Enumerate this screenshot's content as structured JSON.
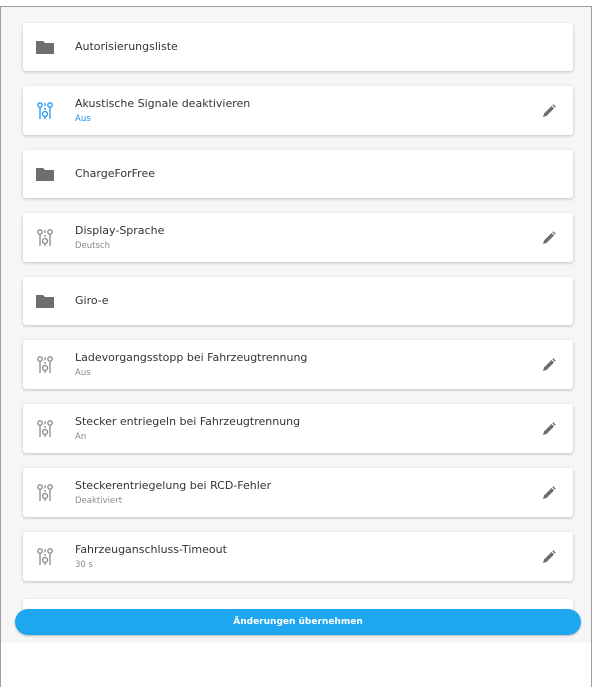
{
  "settings": [
    {
      "label": "Autorisierungsliste",
      "type": "folder"
    },
    {
      "label": "Akustische Signale deaktivieren",
      "value": "Aus",
      "type": "setting",
      "highlighted": true
    },
    {
      "label": "ChargeForFree",
      "type": "folder"
    },
    {
      "label": "Display-Sprache",
      "value": "Deutsch",
      "type": "setting"
    },
    {
      "label": "Giro-e",
      "type": "folder"
    },
    {
      "label": "Ladevorgangsstopp bei Fahrzeugtrennung",
      "value": "Aus",
      "type": "setting"
    },
    {
      "label": "Stecker entriegeln bei Fahrzeugtrennung",
      "value": "An",
      "type": "setting"
    },
    {
      "label": "Steckerentriegelung bei RCD-Fehler",
      "value": "Deaktiviert",
      "type": "setting"
    },
    {
      "label": "Fahrzeuganschluss-Timeout",
      "value": "30 s",
      "type": "setting"
    }
  ],
  "apply_button": {
    "label": "Änderungen übernehmen"
  },
  "icons": {
    "folder": "folder-icon",
    "setting": "tune-icon",
    "edit": "pencil-icon"
  },
  "colors": {
    "accent": "#2196f3",
    "button": "#1ea7ef",
    "icon_gray": "#6e6e6e"
  }
}
